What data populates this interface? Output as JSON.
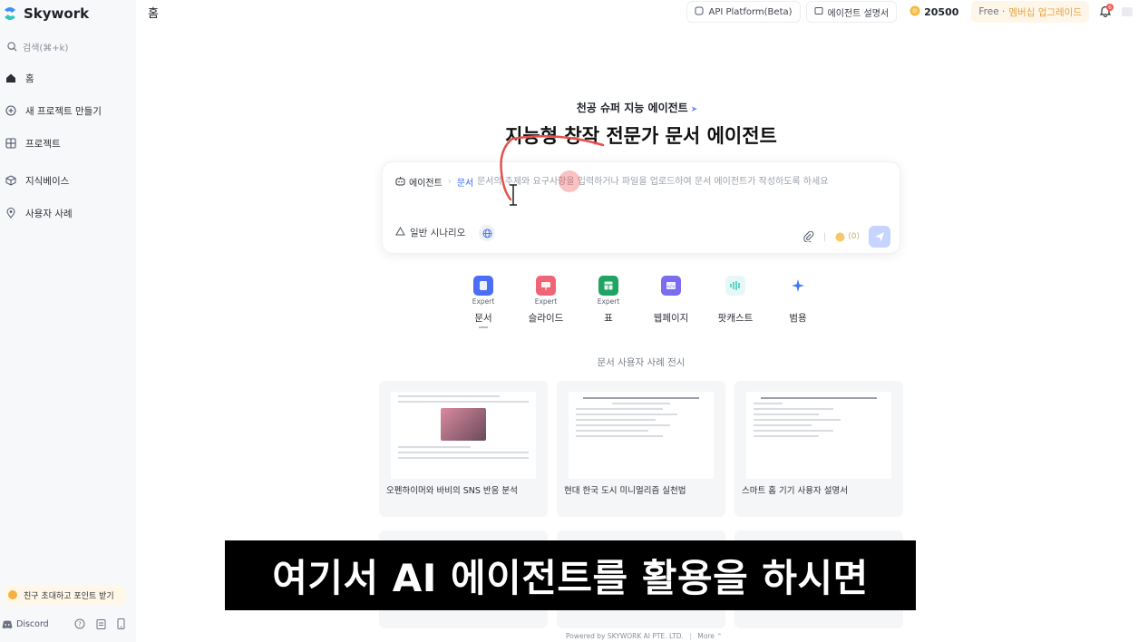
{
  "sidebar": {
    "logo_text": "Skywork",
    "search_placeholder": "검색(⌘+k)",
    "items": [
      {
        "label": "홈",
        "icon": "home-icon"
      },
      {
        "label": "새 프로젝트 만들기",
        "icon": "plus-circle-icon"
      },
      {
        "label": "프로젝트",
        "icon": "project-icon"
      },
      {
        "label": "지식베이스",
        "icon": "cube-icon"
      },
      {
        "label": "사용자 사례",
        "icon": "location-icon"
      }
    ],
    "invite_label": "친구 초대하고 포인트 받기",
    "discord_label": "Discord"
  },
  "header": {
    "page_title": "홈",
    "api_label": "API Platform(Beta)",
    "agent_guide_label": "에이전트 설명서",
    "points": "20500",
    "plan_free": "Free ·",
    "plan_upgrade": "멤버십 업그레이드",
    "notification_count": "6"
  },
  "hero": {
    "subtitle": "천공 슈퍼 지능 에이전트",
    "title": "지능형 창작 전문가 문서 에이전트"
  },
  "prompt": {
    "agent_label": "에이전트",
    "agent_type": "문서",
    "placeholder": "문서의 주제와 요구사항을 입력하거나 파일을 업로드하여 문서 에이전트가 작성하도록 하세요",
    "scenario_label": "일반 시나리오",
    "cost_points": "(0)"
  },
  "agents": [
    {
      "label": "문서",
      "expert": "Expert",
      "color": "#4c6ef5"
    },
    {
      "label": "슬라이드",
      "expert": "Expert",
      "color": "#f06575"
    },
    {
      "label": "표",
      "expert": "Expert",
      "color": "#1fa463"
    },
    {
      "label": "웹페이지",
      "expert": "",
      "color": "#7b6cf0"
    },
    {
      "label": "팟캐스트",
      "expert": "",
      "color": "#2bc7b4"
    },
    {
      "label": "범용",
      "expert": "",
      "color": "#3d7cf5"
    }
  ],
  "showcase": {
    "title": "문서 사용자 사례 전시",
    "cards": [
      {
        "label": "오펜하이머와 바비의 SNS 반응 분석"
      },
      {
        "label": "현대 한국 도시 미니멀리즘 실천법"
      },
      {
        "label": "스마트 홈 기기 사용자 설명서"
      }
    ]
  },
  "subtitle_caption": "여기서 AI 에이전트를 활용을 하시면",
  "footer": {
    "powered_by": "Powered by SKYWORK AI PTE. LTD.",
    "more_label": "More"
  }
}
